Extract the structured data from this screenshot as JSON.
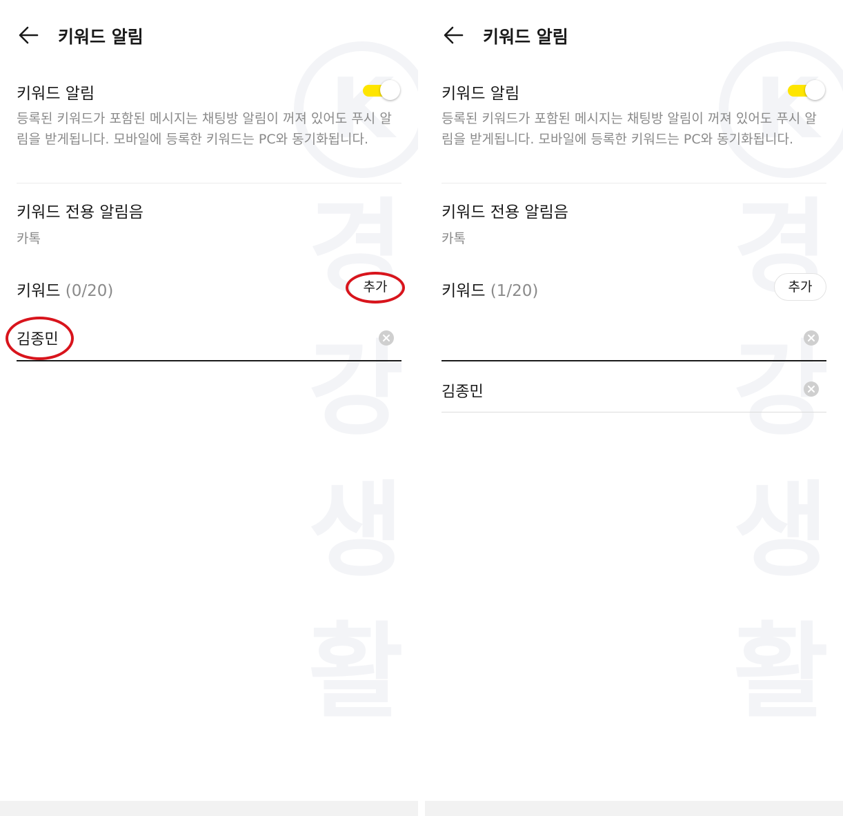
{
  "colors": {
    "toggle_on": "#fee500",
    "annotation": "#d8141c",
    "watermark": "#f3f4f7"
  },
  "watermark": {
    "letters": [
      "K",
      "경",
      "강",
      "생",
      "활"
    ]
  },
  "left": {
    "header": {
      "back_icon": "arrow-left-icon",
      "title": "키워드 알림"
    },
    "keyword_alert": {
      "title": "키워드 알림",
      "enabled": true,
      "description": "등록된 키워드가 포함된 메시지는 채팅방 알림이 꺼져 있어도 푸시 알림을 받게됩니다. 모바일에 등록한 키워드는 PC와 동기화됩니다."
    },
    "sound": {
      "title": "키워드 전용 알림음",
      "value": "카톡"
    },
    "keywords": {
      "label": "키워드",
      "count": "(0/20)",
      "add_label": "추가"
    },
    "input": {
      "value": "김종민"
    },
    "list": []
  },
  "right": {
    "header": {
      "back_icon": "arrow-left-icon",
      "title": "키워드 알림"
    },
    "keyword_alert": {
      "title": "키워드 알림",
      "enabled": true,
      "description": "등록된 키워드가 포함된 메시지는 채팅방 알림이 꺼져 있어도 푸시 알림을 받게됩니다. 모바일에 등록한 키워드는 PC와 동기화됩니다."
    },
    "sound": {
      "title": "키워드 전용 알림음",
      "value": "카톡"
    },
    "keywords": {
      "label": "키워드",
      "count": "(1/20)",
      "add_label": "추가"
    },
    "input": {
      "value": ""
    },
    "list": [
      "김종민"
    ]
  }
}
